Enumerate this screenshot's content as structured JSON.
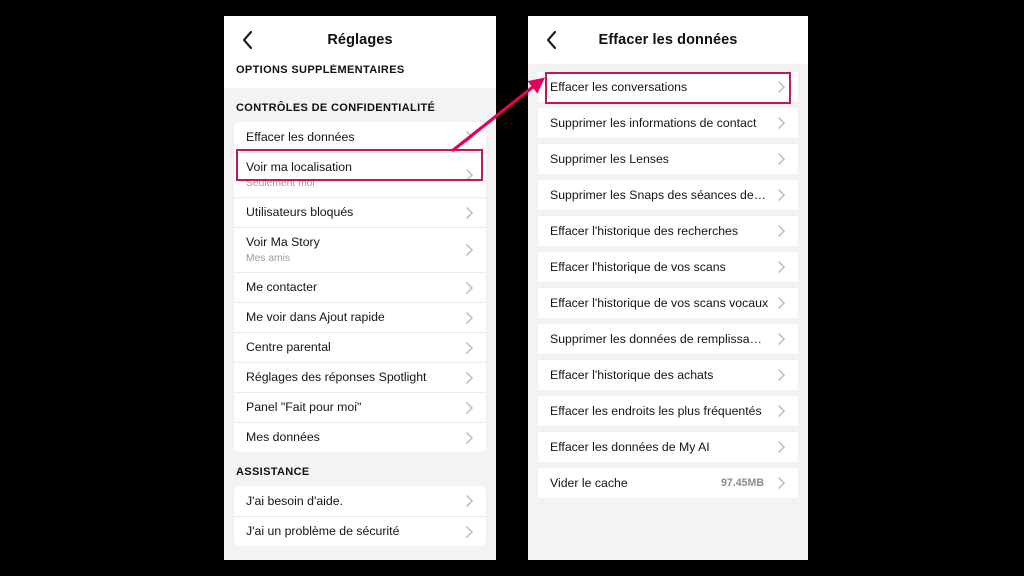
{
  "annotation": {
    "highlight_color": "#c2185b",
    "arrow_color": "#e6005c",
    "arrow_from": "effacer-les-donnees-row",
    "arrow_to": "effacer-les-conversations-row"
  },
  "left_phone": {
    "header": {
      "back_icon": "back-chevron-icon",
      "title": "Réglages",
      "section_label": "OPTIONS SUPPLÉMENTAIRES"
    },
    "sections": [
      {
        "title": "CONTRÔLES DE CONFIDENTIALITÉ",
        "rows": [
          {
            "label": "Effacer les données",
            "sub": "",
            "value": "",
            "highlighted": true
          },
          {
            "label": "Voir ma localisation",
            "sub": "Seulement moi",
            "value": ""
          },
          {
            "label": "Utilisateurs bloqués",
            "sub": "",
            "value": ""
          },
          {
            "label": "Voir Ma Story",
            "sub": "Mes amis",
            "value": ""
          },
          {
            "label": "Me contacter",
            "sub": "",
            "value": ""
          },
          {
            "label": "Me voir dans Ajout rapide",
            "sub": "",
            "value": ""
          },
          {
            "label": "Centre parental",
            "sub": "",
            "value": ""
          },
          {
            "label": "Réglages des réponses Spotlight",
            "sub": "",
            "value": ""
          },
          {
            "label": "Panel \"Fait pour moi\"",
            "sub": "",
            "value": ""
          },
          {
            "label": "Mes données",
            "sub": "",
            "value": ""
          }
        ]
      },
      {
        "title": "ASSISTANCE",
        "rows": [
          {
            "label": "J'ai besoin d'aide.",
            "sub": "",
            "value": ""
          },
          {
            "label": "J'ai un problème de sécurité",
            "sub": "",
            "value": ""
          }
        ]
      }
    ]
  },
  "right_phone": {
    "header": {
      "back_icon": "back-chevron-icon",
      "title": "Effacer les données"
    },
    "rows": [
      {
        "label": "Effacer les conversations",
        "value": "",
        "highlighted": true
      },
      {
        "label": "Supprimer les informations de contact",
        "value": ""
      },
      {
        "label": "Supprimer les Lenses",
        "value": ""
      },
      {
        "label": "Supprimer les Snaps des séances de…",
        "value": ""
      },
      {
        "label": "Effacer l'historique des recherches",
        "value": ""
      },
      {
        "label": "Effacer l'historique de vos scans",
        "value": ""
      },
      {
        "label": "Effacer l'historique de vos scans vocaux",
        "value": ""
      },
      {
        "label": "Supprimer les données de remplissa…",
        "value": ""
      },
      {
        "label": "Effacer l'historique des achats",
        "value": ""
      },
      {
        "label": "Effacer les endroits les plus fréquentés",
        "value": ""
      },
      {
        "label": "Effacer les données de My AI",
        "value": ""
      },
      {
        "label": "Vider le cache",
        "value": "97.45MB"
      }
    ]
  }
}
